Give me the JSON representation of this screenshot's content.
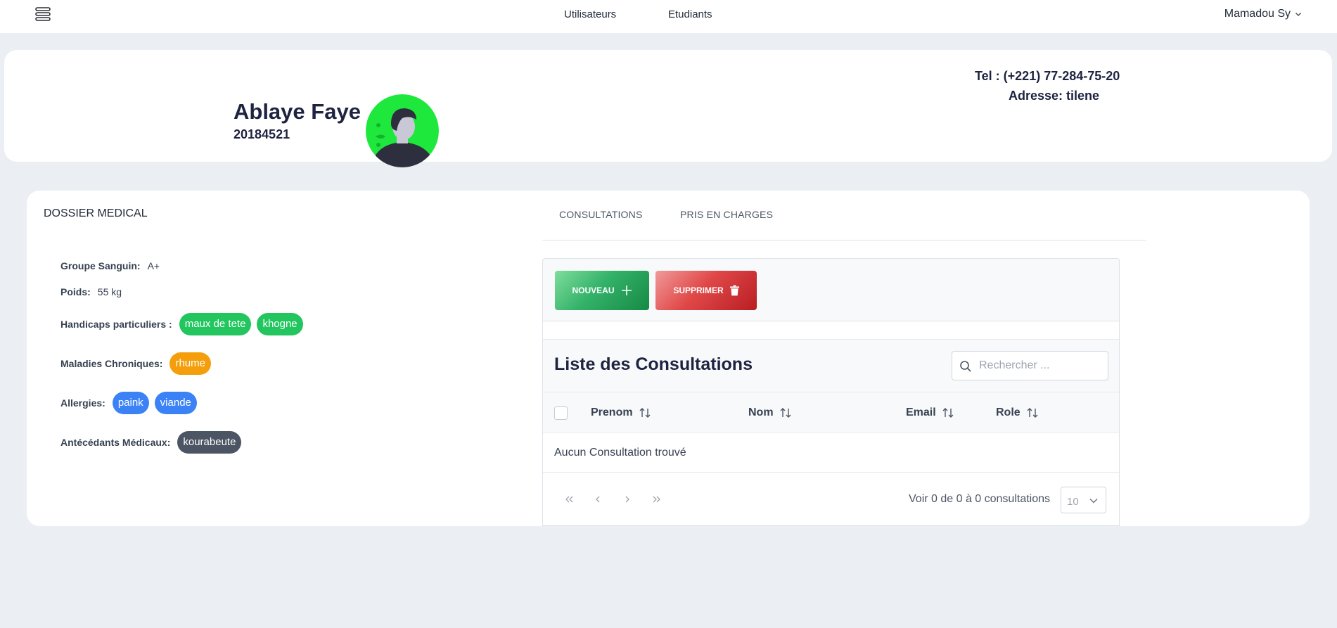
{
  "nav": {
    "menu_icon": "menu-icon",
    "links": [
      "Utilisateurs",
      "Etudiants"
    ],
    "user_name": "Mamadou Sy"
  },
  "profile": {
    "name": "Ablaye Faye",
    "id": "20184521",
    "tel": "Tel : (+221) 77-284-75-20",
    "address": "Adresse: tilene",
    "avatar_color": "#1ee83c"
  },
  "dossier": {
    "title": "DOSSIER MEDICAL",
    "groupe_label": "Groupe Sanguin:",
    "groupe_value": "A+",
    "poids_label": "Poids:",
    "poids_value": "55 kg",
    "handicaps_label": "Handicaps particuliers :",
    "handicaps": [
      "maux de tete",
      "khogne"
    ],
    "maladies_label": "Maladies Chroniques:",
    "maladies": [
      "rhume"
    ],
    "allergies_label": "Allergies:",
    "allergies": [
      "paink",
      "viande"
    ],
    "antecedents_label": "Antécédants Médicaux:",
    "antecedents": [
      "kourabeute"
    ]
  },
  "tabs": [
    "CONSULTATIONS",
    "PRIS EN CHARGES"
  ],
  "toolbar": {
    "new_label": "NOUVEAU",
    "delete_label": "SUPPRIMER"
  },
  "table": {
    "title": "Liste des Consultations",
    "search_placeholder": "Rechercher ...",
    "columns": [
      "Prenom",
      "Nom",
      "Email",
      "Role"
    ],
    "empty_message": "Aucun Consultation trouvé",
    "page_info": "Voir 0 de 0 à 0 consultations",
    "page_size": "10"
  },
  "colors": {
    "green_chip": "#22c55e",
    "orange_chip": "#f59e0b",
    "blue_chip": "#3b82f6",
    "dark_chip": "#4b5563",
    "new_button": "#22a052",
    "delete_button": "#d63031"
  }
}
